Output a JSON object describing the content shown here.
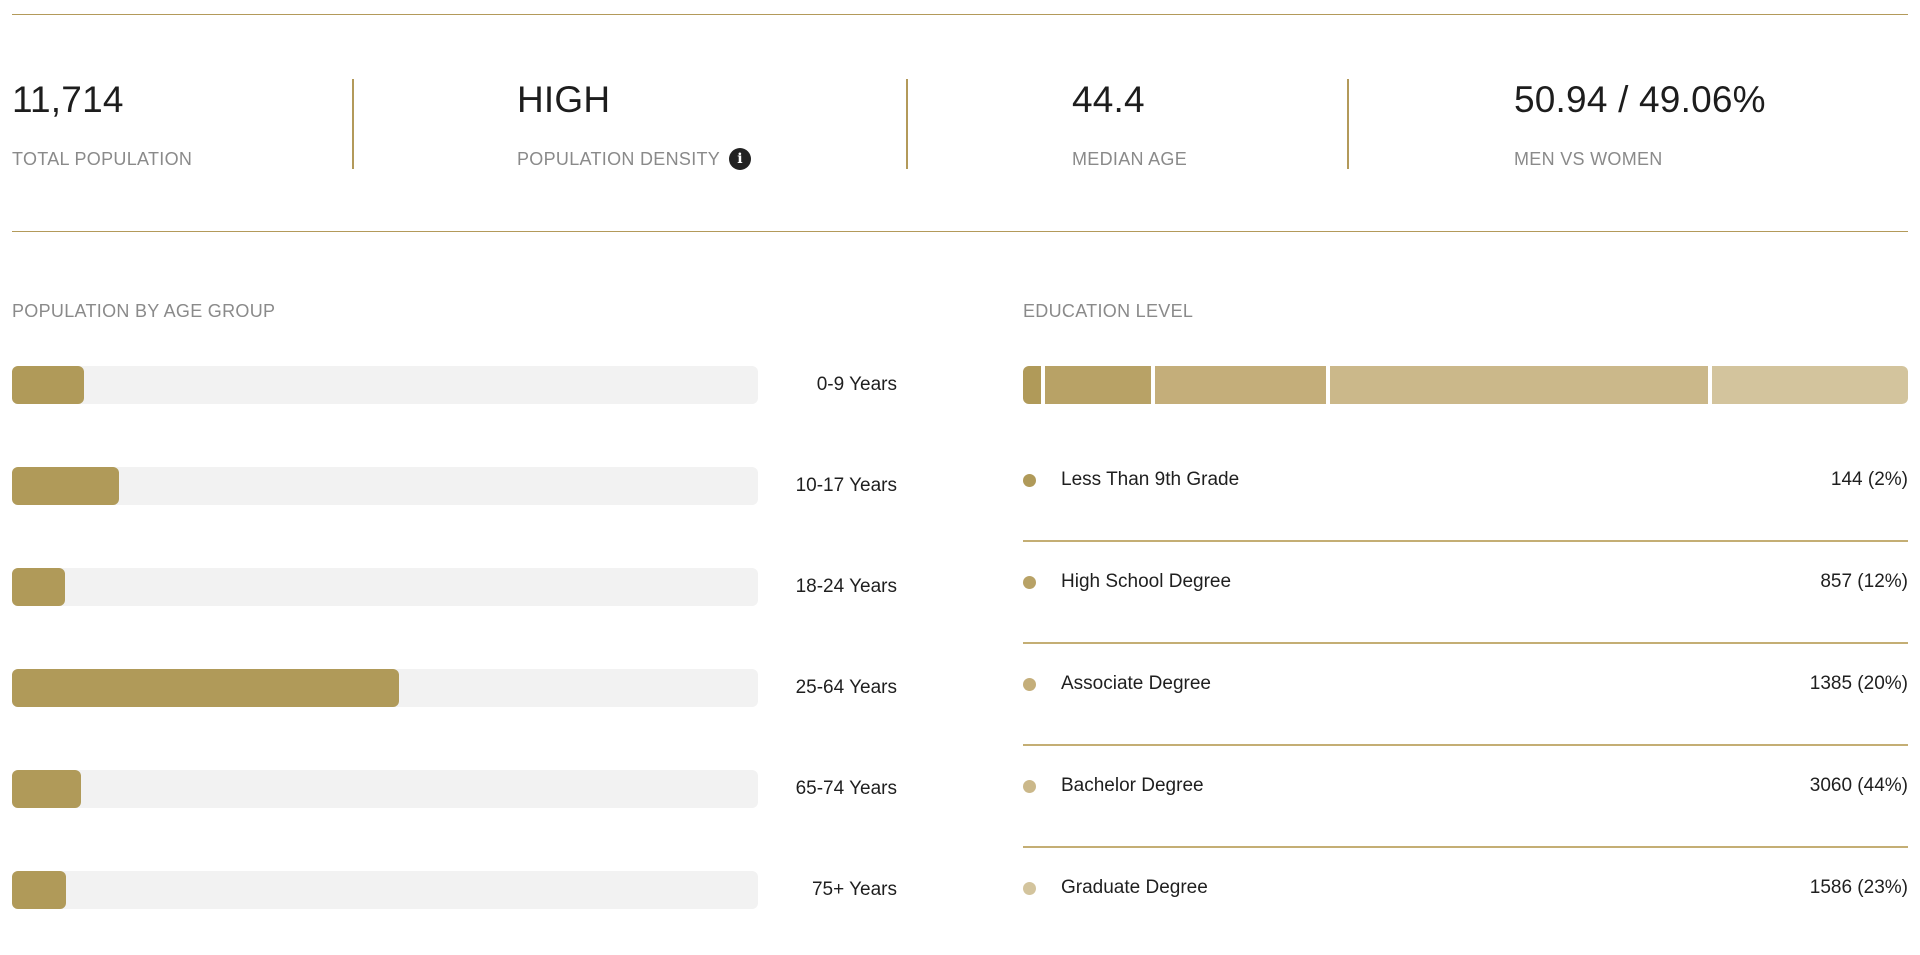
{
  "stats": [
    {
      "value": "11,714",
      "label": "TOTAL POPULATION"
    },
    {
      "value": "HIGH",
      "label": "POPULATION DENSITY"
    },
    {
      "value": "44.4",
      "label": "MEDIAN AGE"
    },
    {
      "value": "50.94 / 49.06%",
      "label": "MEN VS WOMEN"
    }
  ],
  "icons": {
    "info": "info-icon"
  },
  "colors": {
    "accent": "#b39a5a",
    "bar_fill": "#b09a59",
    "bar_track": "#f2f2f2"
  },
  "age": {
    "title": "POPULATION BY AGE GROUP",
    "groups": [
      {
        "label": "0-9 Years",
        "share": 0.096
      },
      {
        "label": "10-17 Years",
        "share": 0.143
      },
      {
        "label": "18-24 Years",
        "share": 0.071
      },
      {
        "label": "25-64 Years",
        "share": 0.518
      },
      {
        "label": "65-74 Years",
        "share": 0.092
      },
      {
        "label": "75+ Years",
        "share": 0.072
      }
    ]
  },
  "education": {
    "title": "EDUCATION LEVEL",
    "items": [
      {
        "label": "Less Than 9th Grade",
        "value": "144 (2%)",
        "count": 144,
        "color": "#b09a59"
      },
      {
        "label": "High School Degree",
        "value": "857 (12%)",
        "count": 857,
        "color": "#b8a266"
      },
      {
        "label": "Associate Degree",
        "value": "1385 (20%)",
        "count": 1385,
        "color": "#c4ae7a"
      },
      {
        "label": "Bachelor Degree",
        "value": "3060 (44%)",
        "count": 3060,
        "color": "#cbb88a"
      },
      {
        "label": "Graduate Degree",
        "value": "1586 (23%)",
        "count": 1586,
        "color": "#d3c49d"
      }
    ]
  }
}
